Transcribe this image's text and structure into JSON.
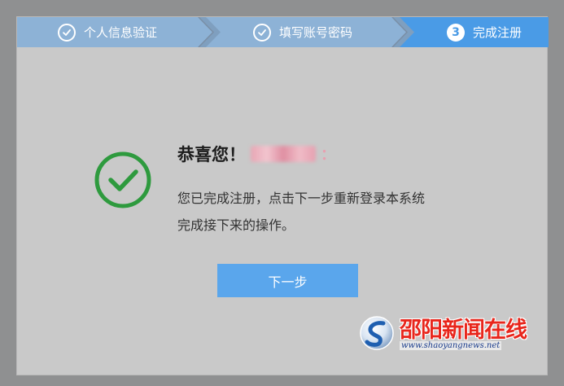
{
  "steps": [
    {
      "label": "个人信息验证",
      "state": "done",
      "icon": "check-icon"
    },
    {
      "label": "填写账号密码",
      "state": "done",
      "icon": "check-icon"
    },
    {
      "label": "完成注册",
      "state": "current",
      "number": "3"
    }
  ],
  "success": {
    "title": "恭喜您！",
    "colon": "：",
    "line1": "您已完成注册，点击下一步重新登录本系统",
    "line2": "完成接下来的操作。"
  },
  "next_button": {
    "label": "下一步"
  },
  "watermark": {
    "name": "邵阳新闻在线",
    "url": "www.shaoyangnews.net"
  },
  "colors": {
    "step_done": "#8db2d6",
    "step_current": "#4a9be6",
    "success_green": "#2e9a3e",
    "button": "#5aa6ec",
    "watermark_red": "#e8261c"
  }
}
